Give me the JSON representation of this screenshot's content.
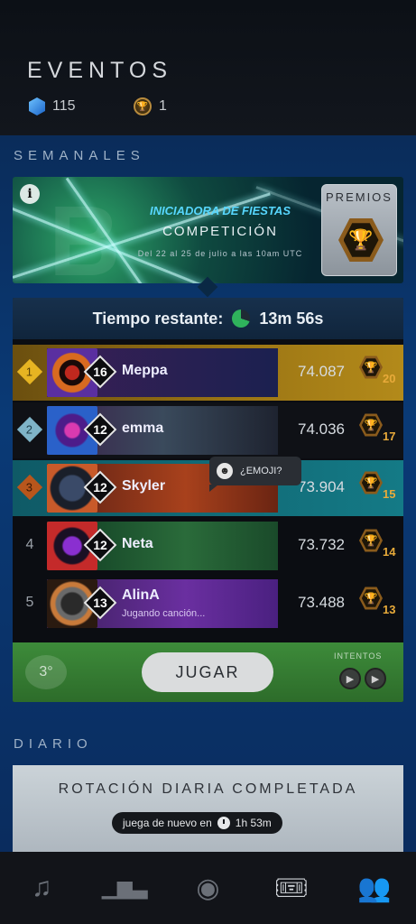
{
  "header": {
    "title": "EVENTOS",
    "gems": "115",
    "tokens": "1"
  },
  "sections": {
    "weekly": "SEMANALES",
    "daily": "DIARIO"
  },
  "event": {
    "name": "INICIADORA DE FIESTAS",
    "type": "COMPETICIÓN",
    "dates": "Del 22 al 25 de julio a las 10am UTC",
    "prizes_label": "PREMIOS"
  },
  "timer": {
    "label": "Tiempo restante:",
    "value": "13m 56s"
  },
  "leaderboard": [
    {
      "rank": "1",
      "level": "16",
      "name": "Meppa",
      "status": "",
      "score": "74.087",
      "reward": "20"
    },
    {
      "rank": "2",
      "level": "12",
      "name": "emma",
      "status": "",
      "score": "74.036",
      "reward": "17"
    },
    {
      "rank": "3",
      "level": "12",
      "name": "Skyler",
      "status": "",
      "score": "73.904",
      "reward": "15"
    },
    {
      "rank": "4",
      "level": "12",
      "name": "Neta",
      "status": "",
      "score": "73.732",
      "reward": "14"
    },
    {
      "rank": "5",
      "level": "13",
      "name": "AlinA",
      "status": "Jugando canción...",
      "score": "73.488",
      "reward": "13"
    }
  ],
  "emoji_bubble": "¿EMOJI?",
  "play": {
    "place": "3°",
    "button": "JUGAR",
    "tries_label": "INTENTOS"
  },
  "daily": {
    "title": "ROTACIÓN DIARIA COMPLETADA",
    "again_label": "juega de nuevo en",
    "again_time": "1h 53m"
  },
  "nav": [
    "music-plus-icon",
    "podium-icon",
    "play-disc-icon",
    "ticket-star-icon",
    "group-icon"
  ]
}
